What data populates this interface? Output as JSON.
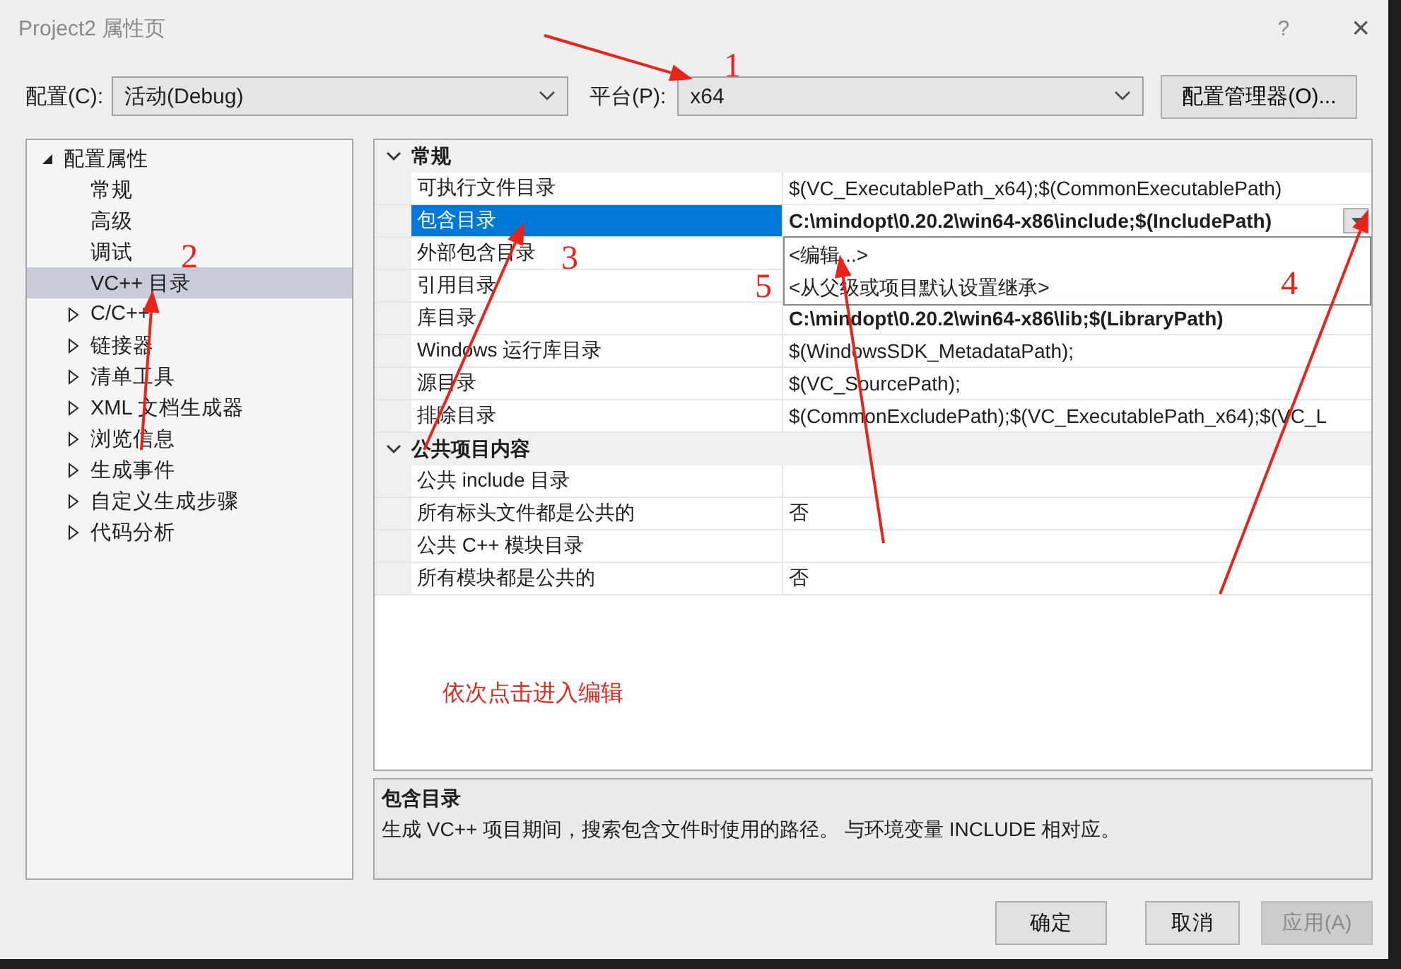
{
  "window": {
    "title": "Project2 属性页",
    "help": "?",
    "close": "×"
  },
  "config": {
    "label": "配置(C):",
    "value": "活动(Debug)"
  },
  "platform": {
    "label": "平台(P):",
    "value": "x64"
  },
  "manager_button": "配置管理器(O)...",
  "tree": [
    {
      "label": "配置属性",
      "expanded": true,
      "selected": false,
      "children": [
        {
          "label": "常规",
          "selected": false
        },
        {
          "label": "高级",
          "selected": false
        },
        {
          "label": "调试",
          "selected": false
        },
        {
          "label": "VC++ 目录",
          "selected": true
        },
        {
          "label": "C/C++",
          "selected": false,
          "expanded": false
        },
        {
          "label": "链接器",
          "selected": false,
          "expanded": false
        },
        {
          "label": "清单工具",
          "selected": false,
          "expanded": false
        },
        {
          "label": "XML 文档生成器",
          "selected": false,
          "expanded": false
        },
        {
          "label": "浏览信息",
          "selected": false,
          "expanded": false
        },
        {
          "label": "生成事件",
          "selected": false,
          "expanded": false
        },
        {
          "label": "自定义生成步骤",
          "selected": false,
          "expanded": false
        },
        {
          "label": "代码分析",
          "selected": false,
          "expanded": false
        }
      ]
    }
  ],
  "grid": {
    "groups": [
      {
        "title": "常规",
        "expanded": true,
        "rows": [
          {
            "name": "可执行文件目录",
            "value": "$(VC_ExecutablePath_x64);$(CommonExecutablePath)",
            "modified": false,
            "selected": false
          },
          {
            "name": "包含目录",
            "value": "C:\\mindopt\\0.20.2\\win64-x86\\include;$(IncludePath)",
            "modified": true,
            "selected": true,
            "dropdown": [
              "<编辑...>",
              "<从父级或项目默认设置继承>"
            ]
          },
          {
            "name": "外部包含目录",
            "value": "",
            "selected": false
          },
          {
            "name": "引用目录",
            "value": "",
            "selected": false
          },
          {
            "name": "库目录",
            "value": "C:\\mindopt\\0.20.2\\win64-x86\\lib;$(LibraryPath)",
            "modified": true,
            "selected": false
          },
          {
            "name": "Windows 运行库目录",
            "value": "$(WindowsSDK_MetadataPath);",
            "modified": false,
            "selected": false
          },
          {
            "name": "源目录",
            "value": "$(VC_SourcePath);",
            "modified": false,
            "selected": false
          },
          {
            "name": "排除目录",
            "value": "$(CommonExcludePath);$(VC_ExecutablePath_x64);$(VC_L",
            "modified": false,
            "selected": false
          }
        ]
      },
      {
        "title": "公共项目内容",
        "expanded": true,
        "rows": [
          {
            "name": "公共 include 目录",
            "value": "",
            "selected": false
          },
          {
            "name": "所有标头文件都是公共的",
            "value": "否",
            "modified": false,
            "selected": false
          },
          {
            "name": "公共 C++ 模块目录",
            "value": "",
            "selected": false
          },
          {
            "name": "所有模块都是公共的",
            "value": "否",
            "modified": false,
            "selected": false
          }
        ]
      }
    ]
  },
  "description": {
    "title": "包含目录",
    "text": "生成 VC++ 项目期间，搜索包含文件时使用的路径。 与环境变量 INCLUDE 相对应。"
  },
  "buttons": [
    {
      "label": "确定",
      "disabled": false
    },
    {
      "label": "取消",
      "disabled": false
    },
    {
      "label": "应用(A)",
      "disabled": true
    }
  ],
  "annotations": {
    "markers": [
      "1",
      "2",
      "3",
      "4",
      "5"
    ],
    "note": "依次点击进入编辑"
  }
}
